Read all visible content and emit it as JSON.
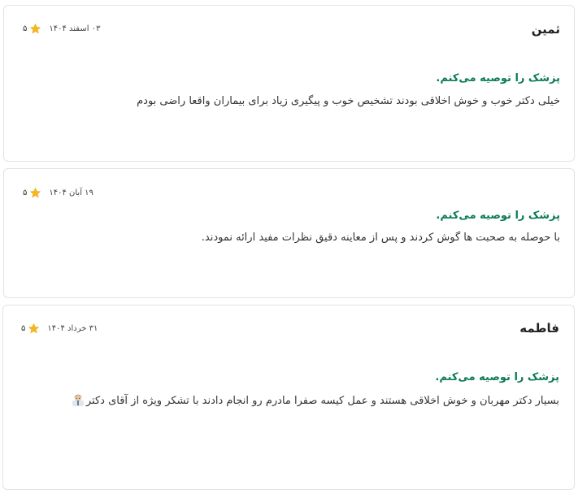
{
  "reviews": [
    {
      "name": "ثمین",
      "date": "۰۳ اسفند ۱۴۰۴",
      "rating": "۵",
      "recommend": "پزشک را توصیه می‌کنم.",
      "comment": "خیلی دکتر خوب و خوش اخلاقی بودند تشخیص خوب و پیگیری زیاد برای بیماران واقعا راضی بودم"
    },
    {
      "name": "",
      "date": "۱۹ آبان ۱۴۰۴",
      "rating": "۵",
      "recommend": "پزشک را توصیه می‌کنم.",
      "comment": "با حوصله به صحبت ها گوش کردند و پس از معاینه دقیق نظرات مفید ارائه نمودند."
    },
    {
      "name": "فاطمه",
      "date": "۳۱ خرداد ۱۴۰۴",
      "rating": "۵",
      "recommend": "پزشک را توصیه می‌کنم.",
      "comment": "بسیار دکتر مهربان و خوش اخلاقی هستند و عمل کیسه صفرا مادرم رو انجام دادند با تشکر ویژه از آقای دکتر"
    }
  ],
  "colors": {
    "recommend": "#0b7a57",
    "star": "#f5b81c",
    "border": "#e3e3e3"
  },
  "icons": {
    "star": "star-icon",
    "emoji": "doctor-emoji-icon"
  }
}
